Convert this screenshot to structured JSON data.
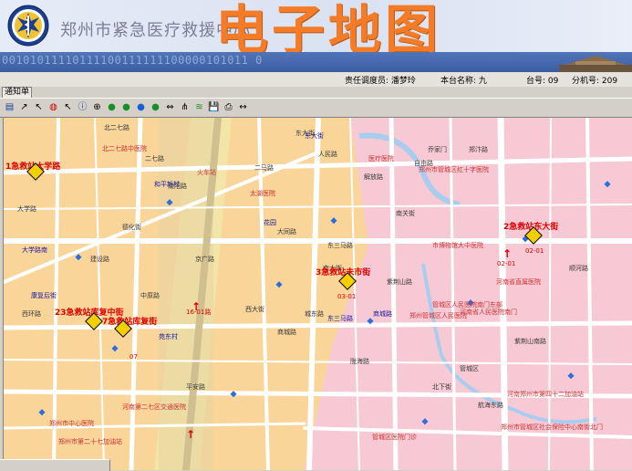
{
  "header": {
    "center_name": "郑州市紧急医疗救援中心",
    "big_title": "电子地图",
    "binary_strip": "00101011110111100111111100000101011 0"
  },
  "infobar": {
    "dispatcher": "责任调度员: 潘梦玲",
    "station_name": "本台名称: 九",
    "desk_no": "台号: 09",
    "ext_no": "分机号: 209"
  },
  "tab": {
    "label": "通知单"
  },
  "toolbar": {
    "tools": [
      "new-doc-icon",
      "arrow-icon",
      "cursor-icon",
      "circle-icon",
      "cursor-pointer-icon",
      "info-icon",
      "zoom-icon",
      "globe-1-icon",
      "globe-2-icon",
      "globe-3-icon",
      "globe-4-icon",
      "fit-icon",
      "route-icon",
      "layer-icon",
      "save-icon",
      "print-icon",
      "measure-icon"
    ],
    "glyphs": [
      "▤",
      "↗",
      "↖",
      "◍",
      "↖",
      "ⓘ",
      "⊕",
      "●",
      "●",
      "●",
      "●",
      "⇔",
      "⋔",
      "≋",
      "💾",
      "⎙",
      "↔"
    ]
  },
  "colors": {
    "map_left": "#f9d59a",
    "map_right": "#f7c9d4",
    "map_river": "#b8d4ee",
    "road": "#ffffff",
    "station_red": "#e00000",
    "poi_blue": "#2a6fe0"
  },
  "map": {
    "stations": [
      {
        "name": "1急救站大学路",
        "code": ""
      },
      {
        "name": "2急救站东大街",
        "code": "02-01"
      },
      {
        "name": "3急救站未市街",
        "code": "03-01"
      },
      {
        "name": "23急救站库复中街",
        "code": ""
      },
      {
        "name": "7急救站库复街",
        "code": ""
      }
    ],
    "unit_labels": [
      "16-01路",
      "07",
      "02-01"
    ],
    "pois": [
      "北二七路中医院",
      "医疗医院",
      "市博物馆大中医院",
      "郑州市管城区红十字医院",
      "太湖医院",
      "河南省直属医院",
      "郑州管城区人民医院",
      "河南省人民医院南门",
      "管城区人民医院南门东部",
      "火车站",
      "河南郑州市第四十二加油站",
      "郑州市管城区社会保险中心南街北门",
      "郑州市中心医院",
      "管城区医院门诊",
      "河南第二七区交通医院",
      "郑州市第二十七加油站"
    ],
    "roads": [
      "北二七路",
      "二七路",
      "东大街",
      "人民路",
      "解放路",
      "自由路",
      "乔家门",
      "德化街",
      "二马路",
      "东三马路",
      "西大街",
      "商城路",
      "城东路",
      "南大街",
      "紫荆山路",
      "陇海路",
      "大学路",
      "京广路",
      "南阳路",
      "中原路",
      "建设路",
      "大同路",
      "郑汴路",
      "顺河路",
      "南关街",
      "西环路",
      "平安路",
      "航海东路",
      "北下街",
      "紫荆山南路",
      "管城区"
    ],
    "badges": [
      "和平新村",
      "花园",
      "商城路",
      "东大街",
      "大学路南",
      "康复后街",
      "苑东村",
      "东三马路"
    ]
  }
}
